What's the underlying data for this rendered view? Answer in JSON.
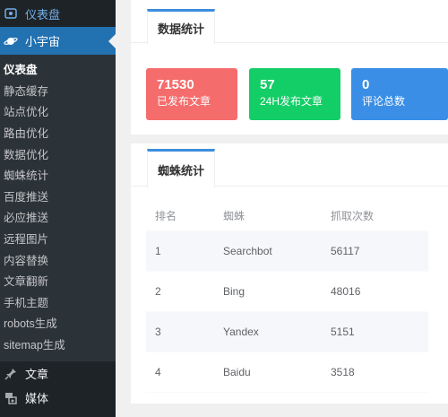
{
  "sidebar": {
    "dashboard_label": "仪表盘",
    "current_label": "小宇宙",
    "submenu": [
      "仪表盘",
      "静态缓存",
      "站点优化",
      "路由优化",
      "数据优化",
      "蜘蛛统计",
      "百度推送",
      "必应推送",
      "远程图片",
      "内容替换",
      "文章翻新",
      "手机主题",
      "robots生成",
      "sitemap生成"
    ],
    "posts_label": "文章",
    "media_label": "媒体"
  },
  "stats_panel": {
    "tab_label": "数据统计",
    "cards": [
      {
        "value": "71530",
        "label": "已发布文章"
      },
      {
        "value": "57",
        "label": "24H发布文章"
      },
      {
        "value": "0",
        "label": "评论总数"
      }
    ]
  },
  "spider_panel": {
    "tab_label": "蜘蛛统计",
    "headers": [
      "排名",
      "蜘蛛",
      "抓取次数"
    ],
    "rows": [
      [
        "1",
        "Searchbot",
        "56117"
      ],
      [
        "2",
        "Bing",
        "48016"
      ],
      [
        "3",
        "Yandex",
        "5151"
      ],
      [
        "4",
        "Baidu",
        "3518"
      ]
    ]
  },
  "colors": {
    "red_card": "#f56c6c",
    "green_card": "#13ce66",
    "blue_card": "#3a8ee6",
    "accent": "#2271b1"
  }
}
